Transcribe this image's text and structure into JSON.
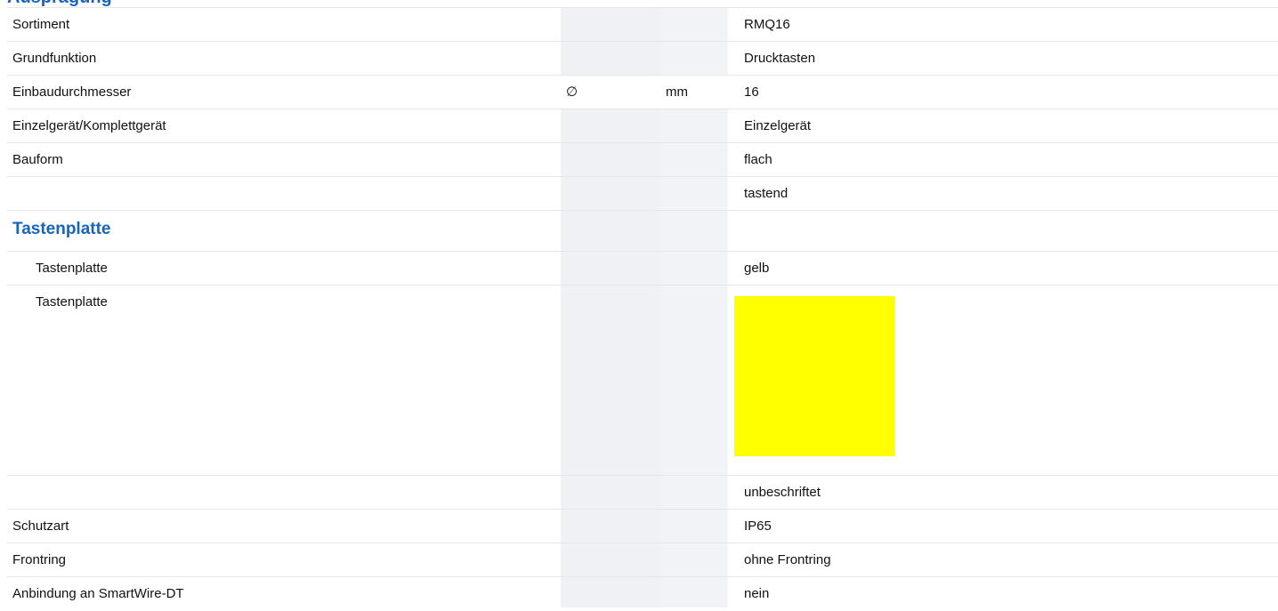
{
  "section_top": {
    "title": "Ausprägung"
  },
  "rows": [
    {
      "label": "Sortiment",
      "symbol": "",
      "unit": "",
      "value": "RMQ16"
    },
    {
      "label": "Grundfunktion",
      "symbol": "",
      "unit": "",
      "value": "Drucktasten"
    },
    {
      "label": "Einbaudurchmesser",
      "symbol": "∅",
      "unit": "mm",
      "value": "16"
    },
    {
      "label": "Einzelgerät/Komplettgerät",
      "symbol": "",
      "unit": "",
      "value": "Einzelgerät"
    },
    {
      "label": "Bauform",
      "symbol": "",
      "unit": "",
      "value": "flach"
    },
    {
      "label": "",
      "symbol": "",
      "unit": "",
      "value": "tastend"
    }
  ],
  "section_tastenplatte": {
    "title": "Tastenplatte",
    "rows": [
      {
        "label": "Tastenplatte",
        "value": "gelb"
      },
      {
        "label": "Tastenplatte",
        "swatch_color": "#ffff00",
        "swatch_name": "yellow-color-swatch"
      }
    ]
  },
  "rows_after": [
    {
      "label": "",
      "value": "unbeschriftet"
    },
    {
      "label": "Schutzart",
      "value": "IP65"
    },
    {
      "label": "Frontring",
      "value": "ohne Frontring"
    },
    {
      "label": "Anbindung an SmartWire-DT",
      "value": "nein"
    }
  ],
  "colors": {
    "accent": "#1565c0",
    "symbol_column": "#eff1f5",
    "unit_column": "#f2f3f6",
    "divider": "#e4e6ea"
  }
}
